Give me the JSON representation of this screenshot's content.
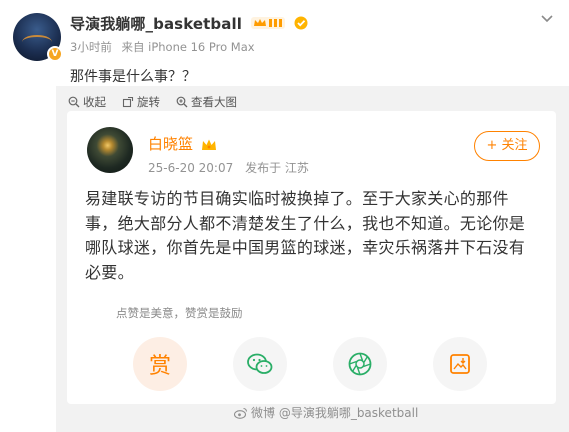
{
  "post": {
    "username": "导演我躺哪_basketball",
    "time": "3小时前",
    "source": "来自 iPhone 16 Pro Max",
    "text": "那件事是什么事？？"
  },
  "toolbar": {
    "collect_label": "收起",
    "rotate_label": "旋转",
    "view_large_label": "查看大图"
  },
  "card": {
    "name": "白晓篮",
    "date": "25-6-20 20:07",
    "location": "发布于 江苏",
    "follow_label": "+ 关注",
    "body": "易建联专访的节目确实临时被换掉了。至于大家关心的那件事，绝大部分人都不清楚发生了什么，我也不知道。无论你是哪队球迷，你首先是中国男篮的球迷，幸灾乐祸落井下石没有必要。",
    "encourage": "点赞是美意，赞赏是鼓励",
    "reward_char": "赏"
  },
  "watermark": "微博 @导演我躺哪_basketball",
  "colors": {
    "accent": "#ff8200",
    "wechat": "#2aae67",
    "moments": "#2aae67"
  }
}
